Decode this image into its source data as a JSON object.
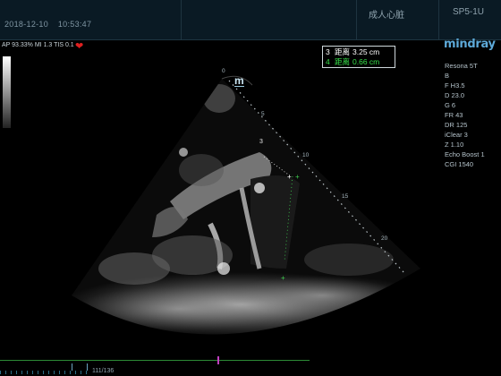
{
  "header": {
    "date": "2018-12-10",
    "time": "10:53:47",
    "preset": "成人心脏",
    "probe": "SP5-1U"
  },
  "status_line": "AP 93.33%  MI 1.3  TIS 0.1",
  "brand": "mindray",
  "params": [
    "Resona 5T",
    "B",
    "F H3.5",
    "D 23.0",
    "G 6",
    "FR 43",
    "DR 125",
    "iClear 3",
    "Z 1.10",
    "Echo Boost 1",
    "CGI 1540"
  ],
  "measurements": [
    {
      "index": "3",
      "label": "距离",
      "value": "3.25 cm"
    },
    {
      "index": "4",
      "label": "距离",
      "value": "0.66 cm"
    }
  ],
  "depth_labels": [
    "0",
    "5",
    "10",
    "15",
    "20"
  ],
  "marker": "m",
  "caliper_label": "3",
  "frame_counter": "111/136",
  "colors": {
    "top_bar": "#0a1a24",
    "brand": "#5da9d8",
    "measure_green": "#37e04a",
    "heart": "#e02020"
  }
}
